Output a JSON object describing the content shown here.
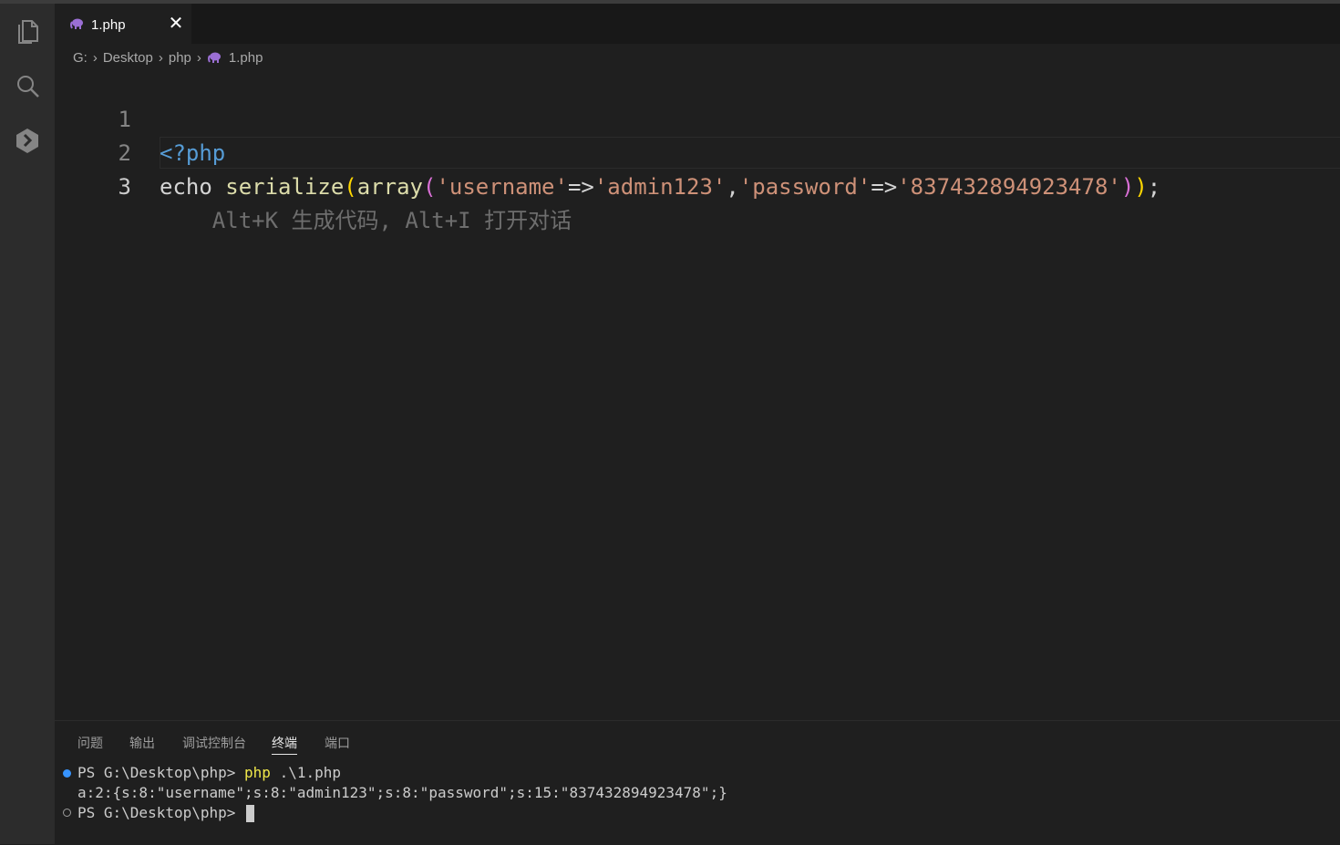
{
  "activity_bar": {
    "items": [
      {
        "icon": "files-icon"
      },
      {
        "icon": "search-icon"
      },
      {
        "icon": "extension-hexagon-icon"
      }
    ]
  },
  "tabs": [
    {
      "label": "1.php",
      "icon": "php-elephant-icon",
      "close_label": "✕",
      "active": true
    }
  ],
  "breadcrumb": {
    "items": [
      "G:",
      "Desktop",
      "php",
      "1.php"
    ],
    "separator": "›"
  },
  "editor": {
    "active_line": 3,
    "lines": [
      {
        "number": "1",
        "text": "<?php"
      },
      {
        "number": "2",
        "text": "echo serialize(array('username'=>'admin123','password'=>'837432894923478'));"
      },
      {
        "number": "3",
        "text": ""
      }
    ],
    "line2_tokens": {
      "echo": "echo ",
      "fn": "serialize",
      "p1_open": "(",
      "fn2": "array",
      "p2_open": "(",
      "k1": "'username'",
      "arrow1": "=>",
      "v1": "'admin123'",
      "comma": ",",
      "k2": "'password'",
      "arrow2": "=>",
      "v2": "'837432894923478'",
      "p2_close": ")",
      "p1_close": ")",
      "semi": ";"
    },
    "inline_hint": "Alt+K 生成代码, Alt+I 打开对话"
  },
  "panel": {
    "tabs": [
      "问题",
      "输出",
      "调试控制台",
      "终端",
      "端口"
    ],
    "active_tab": "终端"
  },
  "terminal": {
    "prompt": "PS G:\\Desktop\\php> ",
    "command": "php",
    "command_args": " .\\1.php",
    "output": "a:2:{s:8:\"username\";s:8:\"admin123\";s:8:\"password\";s:15:\"837432894923478\";}",
    "prompt2": "PS G:\\Desktop\\php> "
  },
  "colors": {
    "editor_bg": "#1f1f1f",
    "activity_bg": "#2c2c2c",
    "keyword": "#569cd6",
    "function": "#dcdcaa",
    "string": "#ce9178",
    "bracket1": "#ffd700",
    "bracket2": "#da70d6",
    "terminal_command": "#f0e84a",
    "status_dot": "#3794ff"
  }
}
